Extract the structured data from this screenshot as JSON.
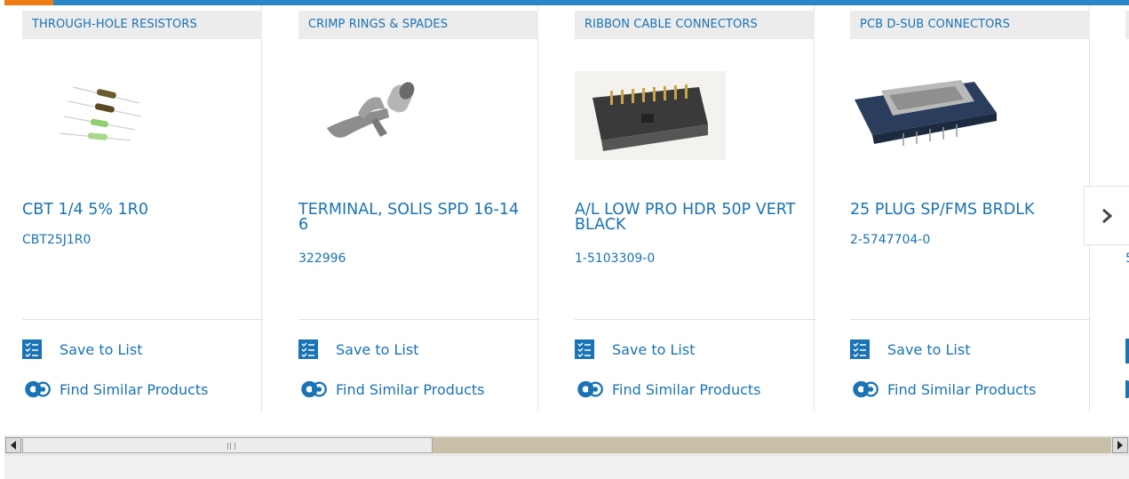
{
  "carousel": {
    "cards": [
      {
        "category": "THROUGH-HOLE RESISTORS",
        "name": "CBT 1/4 5% 1R0",
        "part_number": "CBT25J1R0",
        "save_label": "Save to List",
        "similar_label": "Find Similar Products",
        "image_icon": "resistors-image"
      },
      {
        "category": "CRIMP RINGS & SPADES",
        "name": "TERMINAL, SOLIS SPD 16-14 6",
        "part_number": "322996",
        "save_label": "Save to List",
        "similar_label": "Find Similar Products",
        "image_icon": "spade-terminal-image"
      },
      {
        "category": "RIBBON CABLE CONNECTORS",
        "name": "A/L LOW PRO HDR 50P VERT BLACK",
        "part_number": "1-5103309-0",
        "save_label": "Save to List",
        "similar_label": "Find Similar Products",
        "image_icon": "ribbon-header-image"
      },
      {
        "category": "PCB D-SUB CONNECTORS",
        "name": "25 PLUG SP/FMS BRDLK",
        "part_number": "2-5747704-0",
        "save_label": "Save to List",
        "similar_label": "Find Similar Products",
        "image_icon": "dsub-connector-image"
      }
    ],
    "partial_card": {
      "part_number_fragment": "5"
    },
    "next_icon": "chevron-right-icon"
  },
  "scrollbar": {
    "left_icon": "triangle-left-icon",
    "right_icon": "triangle-right-icon"
  },
  "colors": {
    "link": "#1a73b5",
    "top_bar": "#2a86c8",
    "accent": "#f07c14",
    "category_bg": "#ececec"
  }
}
